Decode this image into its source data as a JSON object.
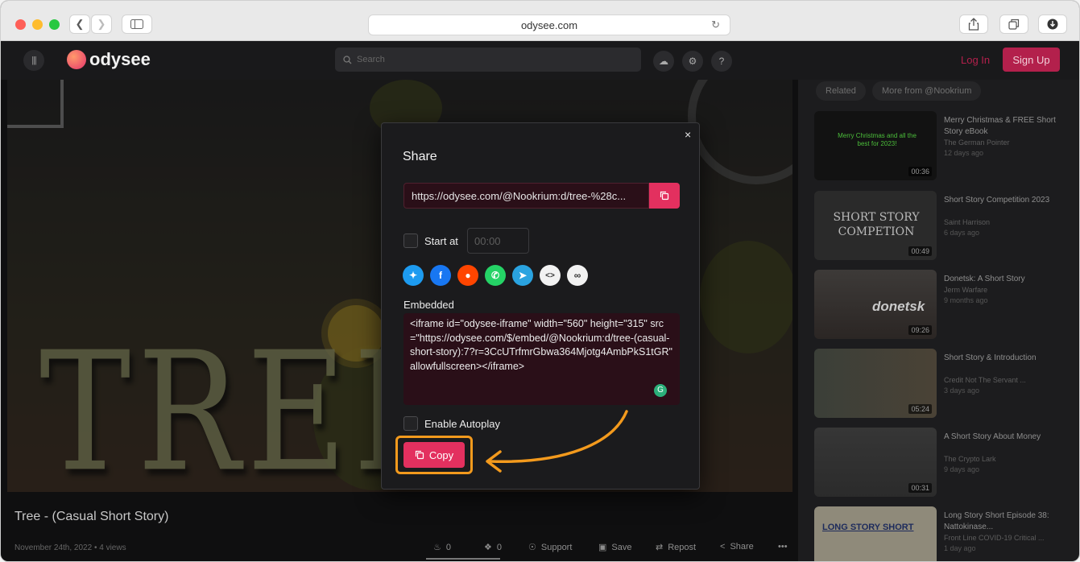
{
  "browser": {
    "url": "odysee.com",
    "traffic_lights": [
      "#fe5f57",
      "#febc2e",
      "#28c840"
    ],
    "back_icon": "chevron-left-icon",
    "forward_icon": "chevron-right-icon"
  },
  "header": {
    "logo_text": "odysee",
    "search_placeholder": "Search",
    "login_label": "Log In",
    "signup_label": "Sign Up",
    "accent_color": "#b3204c"
  },
  "video": {
    "title": "Tree - (Casual Short Story)",
    "overlay_text": "TREE",
    "meta": "November 24th, 2022  •  4 views",
    "actions": [
      {
        "icon": "fire-icon",
        "label": "0"
      },
      {
        "icon": "slime-icon",
        "label": "0"
      },
      {
        "icon": "support-icon",
        "label": "Support"
      },
      {
        "icon": "save-icon",
        "label": "Save"
      },
      {
        "icon": "repost-icon",
        "label": "Repost"
      },
      {
        "icon": "share-icon",
        "label": "Share"
      },
      {
        "icon": "more-icon",
        "label": "•••"
      }
    ]
  },
  "sidebar": {
    "tabs": [
      "Related",
      "More from @Nookrium"
    ],
    "items": [
      {
        "title": "Merry Christmas & FREE Short Story eBook",
        "channel": "The German Pointer",
        "ago": "12 days ago",
        "duration": "00:36",
        "thumb_text": "Merry Christmas and all the best for 2023!"
      },
      {
        "title": "Short Story Competition 2023",
        "channel": "Saint Harrison",
        "ago": "6 days ago",
        "duration": "00:49",
        "thumb_text": "SHORT STORY COMPETION"
      },
      {
        "title": "Donetsk: A Short Story",
        "channel": "Jerm Warfare",
        "ago": "9 months ago",
        "duration": "09:26",
        "thumb_text": "donetsk"
      },
      {
        "title": "Short Story & Introduction",
        "channel": "Credit Not The Servant ...",
        "ago": "3 days ago",
        "duration": "05:24",
        "thumb_text": ""
      },
      {
        "title": "A Short Story About Money",
        "channel": "The Crypto Lark",
        "ago": "9 days ago",
        "duration": "00:31",
        "thumb_text": ""
      },
      {
        "title": "Long Story Short Episode 38: Nattokinase...",
        "channel": "Front Line COVID-19 Critical ...",
        "ago": "1 day ago",
        "duration": "",
        "thumb_text": "LONG STORY SHORT"
      }
    ]
  },
  "share_modal": {
    "title": "Share",
    "close_label": "×",
    "url": "https://odysee.com/@Nookrium:d/tree-%28c...",
    "start_at_label": "Start at",
    "start_at_value": "00:00",
    "socials": [
      "twitter-icon",
      "facebook-icon",
      "reddit-icon",
      "whatsapp-icon",
      "telegram-icon",
      "embed-icon",
      "link-icon"
    ],
    "embedded_label": "Embedded",
    "embed_code": "<iframe id=\"odysee-iframe\" width=\"560\" height=\"315\" src=\"https://odysee.com/$/embed/@Nookrium:d/tree-(casual-short-story):7?r=3CcUTrfmrGbwa364Mjotg4AmbPkS1tGR\" allowfullscreen></iframe>",
    "autoplay_label": "Enable Autoplay",
    "copy_label": "Copy",
    "highlight_color": "#f39a1d",
    "button_color": "#e3305f"
  }
}
